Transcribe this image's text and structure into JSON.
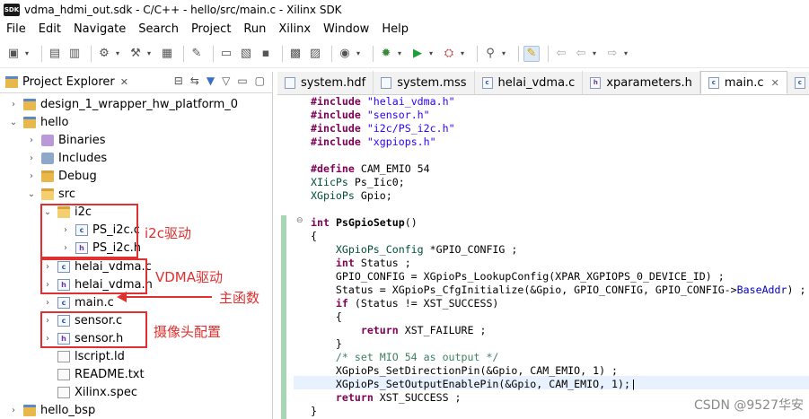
{
  "window": {
    "logo": "SDK",
    "title": "vdma_hdmi_out.sdk - C/C++ - hello/src/main.c - Xilinx SDK"
  },
  "menu": [
    "File",
    "Edit",
    "Navigate",
    "Search",
    "Project",
    "Run",
    "Xilinx",
    "Window",
    "Help"
  ],
  "project_explorer": {
    "title": "Project Explorer",
    "close": "✕",
    "tree": [
      {
        "label": "design_1_wrapper_hw_platform_0",
        "chev": "›"
      },
      {
        "label": "hello",
        "chev": "⌄"
      },
      {
        "label": "Binaries",
        "chev": "›"
      },
      {
        "label": "Includes",
        "chev": "›"
      },
      {
        "label": "Debug",
        "chev": "›"
      },
      {
        "label": "src",
        "chev": "⌄"
      },
      {
        "label": "i2c",
        "chev": "⌄"
      },
      {
        "label": "PS_i2c.c",
        "chev": "›"
      },
      {
        "label": "PS_i2c.h",
        "chev": "›"
      },
      {
        "label": "helai_vdma.c",
        "chev": "›"
      },
      {
        "label": "helai_vdma.h",
        "chev": "›"
      },
      {
        "label": "main.c",
        "chev": "›"
      },
      {
        "label": "sensor.c",
        "chev": "›"
      },
      {
        "label": "sensor.h",
        "chev": "›"
      },
      {
        "label": "lscript.ld",
        "chev": ""
      },
      {
        "label": "README.txt",
        "chev": ""
      },
      {
        "label": "Xilinx.spec",
        "chev": ""
      },
      {
        "label": "hello_bsp",
        "chev": "›"
      }
    ]
  },
  "annotations": {
    "i2c": "i2c驱动",
    "vdma": "VDMA驱动",
    "main": "主函数",
    "camera": "摄像头配置"
  },
  "editor": {
    "tabs": [
      {
        "label": "system.hdf",
        "icon": "hdf-file-icon"
      },
      {
        "label": "system.mss",
        "icon": "mss-file-icon"
      },
      {
        "label": "helai_vdma.c",
        "icon": "c-file-icon"
      },
      {
        "label": "xparameters.h",
        "icon": "h-file-icon"
      },
      {
        "label": "main.c",
        "icon": "c-file-icon",
        "active": true
      }
    ],
    "close": "✕"
  },
  "watermark": "CSDN @9527华安"
}
